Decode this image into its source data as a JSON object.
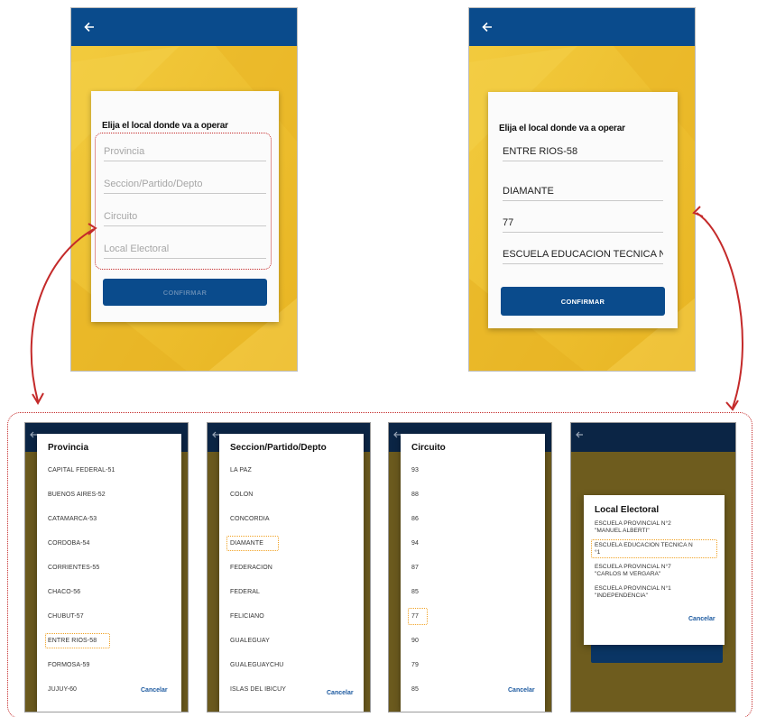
{
  "form_empty": {
    "title": "Elija el local donde va a operar",
    "fields": [
      "Provincia",
      "Seccion/Partido/Depto",
      "Circuito",
      "Local Electoral"
    ],
    "confirm_label": "CONFIRMAR"
  },
  "form_filled": {
    "title": "Elija el local donde va a operar",
    "fields": [
      "ENTRE RIOS-58",
      "DIAMANTE",
      "77",
      "ESCUELA EDUCACION TECNICA N"
    ],
    "confirm_label": "CONFIRMAR"
  },
  "picker_provincia": {
    "title": "Provincia",
    "options": [
      "CAPITAL FEDERAL-51",
      "BUENOS AIRES-52",
      "CATAMARCA-53",
      "CORDOBA-54",
      "CORRIENTES-55",
      "CHACO-56",
      "CHUBUT-57",
      "ENTRE RIOS-58",
      "FORMOSA-59",
      "JUJUY-60"
    ],
    "cancel_label": "Cancelar"
  },
  "picker_seccion": {
    "title": "Seccion/Partido/Depto",
    "options": [
      "LA PAZ",
      "COLON",
      "CONCORDIA",
      "DIAMANTE",
      "FEDERACION",
      "FEDERAL",
      "FELICIANO",
      "GUALEGUAY",
      "GUALEGUAYCHU",
      "ISLAS DEL IBICUY"
    ],
    "cancel_label": "Cancelar"
  },
  "picker_circuito": {
    "title": "Circuito",
    "options": [
      "93",
      "88",
      "86",
      "94",
      "87",
      "85",
      "77",
      "90",
      "79",
      "85"
    ],
    "cancel_label": "Cancelar"
  },
  "picker_local": {
    "title": "Local Electoral",
    "options": [
      {
        "line1": "ESCUELA PROVINCIAL N°2",
        "line2": "\"MANUEL ALBERTI\""
      },
      {
        "line1": "ESCUELA EDUCACION TECNICA N",
        "line2": "°1"
      },
      {
        "line1": "ESCUELA PROVINCIAL N°7",
        "line2": "\"CARLOS M VERGARA\""
      },
      {
        "line1": "ESCUELA PROVINCIAL N°1",
        "line2": "\"INDEPENDENCIA\""
      }
    ],
    "cancel_label": "Cancelar"
  },
  "colors": {
    "topbar": "#0a4b8c",
    "background": "#f0c32e",
    "button": "#0a4b8c",
    "highlight_red": "#c42a2a",
    "highlight_orange": "#f0a020"
  },
  "icons": [
    "back-arrow-icon",
    "curved-arrow-icon"
  ]
}
